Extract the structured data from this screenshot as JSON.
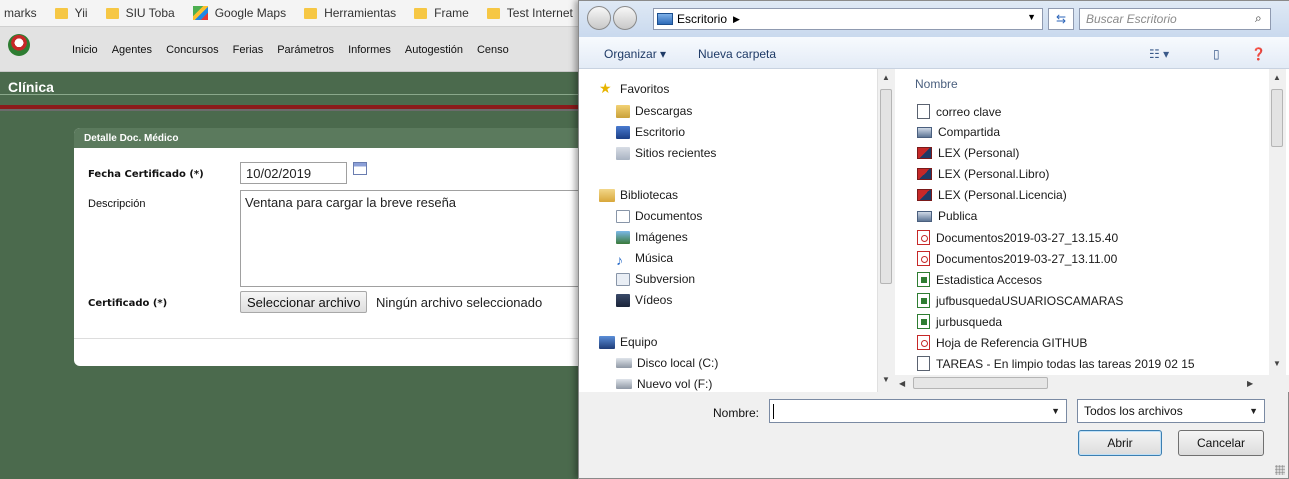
{
  "bookmarks": [
    {
      "label": "marks",
      "icon": "none"
    },
    {
      "label": "Yii",
      "icon": "folder-icon"
    },
    {
      "label": "SIU Toba",
      "icon": "folder-icon"
    },
    {
      "label": "Google Maps",
      "icon": "maps-icon"
    },
    {
      "label": "Herramientas",
      "icon": "folder-icon"
    },
    {
      "label": "Frame",
      "icon": "folder-icon"
    },
    {
      "label": "Test Internet",
      "icon": "folder-icon"
    }
  ],
  "nav": {
    "items": [
      "Inicio",
      "Agentes",
      "Concursos",
      "Ferias",
      "Parámetros",
      "Informes",
      "Autogestión",
      "Censo"
    ]
  },
  "page": {
    "title": "Clínica"
  },
  "form": {
    "header": "Detalle Doc. Médico",
    "fecha_label": "Fecha Certificado (*)",
    "fecha_value": "10/02/2019",
    "descripcion_label": "Descripción",
    "descripcion_value": "Ventana para cargar la breve reseña",
    "certificado_label": "Certificado (*)",
    "file_button": "Seleccionar archivo",
    "file_status": "Ningún archivo seleccionado"
  },
  "dialog": {
    "address": "Escritorio",
    "search_placeholder": "Buscar Escritorio",
    "toolbar": {
      "organize": "Organizar ▾",
      "new_folder": "Nueva carpeta"
    },
    "nav_pane": {
      "favorites_header": "Favoritos",
      "favorites": [
        "Descargas",
        "Escritorio",
        "Sitios recientes"
      ],
      "libraries_header": "Bibliotecas",
      "libraries": [
        "Documentos",
        "Imágenes",
        "Música",
        "Subversion",
        "Vídeos"
      ],
      "computer_header": "Equipo",
      "drives": [
        "Disco local (C:)",
        "Nuevo vol (F:)"
      ]
    },
    "column_header": "Nombre",
    "files": [
      {
        "name": "correo clave",
        "type": "txt"
      },
      {
        "name": "Compartida",
        "type": "net"
      },
      {
        "name": "LEX (Personal)",
        "type": "lex"
      },
      {
        "name": "LEX (Personal.Libro)",
        "type": "lex"
      },
      {
        "name": "LEX (Personal.Licencia)",
        "type": "lex"
      },
      {
        "name": "Publica",
        "type": "net"
      },
      {
        "name": "Documentos2019-03-27_13.15.40",
        "type": "pdf"
      },
      {
        "name": "Documentos2019-03-27_13.11.00",
        "type": "pdf"
      },
      {
        "name": "Estadistica Accesos",
        "type": "xls"
      },
      {
        "name": "jufbusquedaUSUARIOSCAMARAS",
        "type": "xls"
      },
      {
        "name": "jurbusqueda",
        "type": "xls"
      },
      {
        "name": "Hoja de Referencia GITHUB",
        "type": "pdf"
      },
      {
        "name": "TAREAS - En limpio todas las tareas 2019 02 15",
        "type": "txt"
      }
    ],
    "filename_label": "Nombre:",
    "filename_value": "",
    "filter_value": "Todos los archivos",
    "open_button": "Abrir",
    "cancel_button": "Cancelar"
  }
}
